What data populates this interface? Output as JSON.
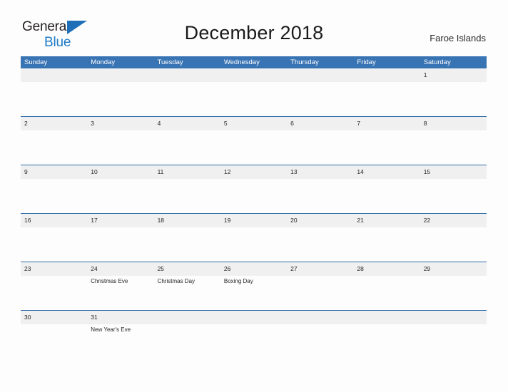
{
  "logo": {
    "word1": "General",
    "word2": "Blue",
    "flag_color": "#1f6fb8",
    "blue_text_color": "#1f7ac7"
  },
  "header": {
    "title": "December 2018",
    "region": "Faroe Islands"
  },
  "theme": {
    "header_blue": "#3873b3",
    "row_divider_blue": "#2e6da8",
    "daynum_band_gray": "#f0f0f0",
    "page_background": "#fdfdfd"
  },
  "calendar": {
    "weekdays": [
      "Sunday",
      "Monday",
      "Tuesday",
      "Wednesday",
      "Thursday",
      "Friday",
      "Saturday"
    ],
    "weeks": [
      [
        {
          "day": "",
          "event": ""
        },
        {
          "day": "",
          "event": ""
        },
        {
          "day": "",
          "event": ""
        },
        {
          "day": "",
          "event": ""
        },
        {
          "day": "",
          "event": ""
        },
        {
          "day": "",
          "event": ""
        },
        {
          "day": "1",
          "event": ""
        }
      ],
      [
        {
          "day": "2",
          "event": ""
        },
        {
          "day": "3",
          "event": ""
        },
        {
          "day": "4",
          "event": ""
        },
        {
          "day": "5",
          "event": ""
        },
        {
          "day": "6",
          "event": ""
        },
        {
          "day": "7",
          "event": ""
        },
        {
          "day": "8",
          "event": ""
        }
      ],
      [
        {
          "day": "9",
          "event": ""
        },
        {
          "day": "10",
          "event": ""
        },
        {
          "day": "11",
          "event": ""
        },
        {
          "day": "12",
          "event": ""
        },
        {
          "day": "13",
          "event": ""
        },
        {
          "day": "14",
          "event": ""
        },
        {
          "day": "15",
          "event": ""
        }
      ],
      [
        {
          "day": "16",
          "event": ""
        },
        {
          "day": "17",
          "event": ""
        },
        {
          "day": "18",
          "event": ""
        },
        {
          "day": "19",
          "event": ""
        },
        {
          "day": "20",
          "event": ""
        },
        {
          "day": "21",
          "event": ""
        },
        {
          "day": "22",
          "event": ""
        }
      ],
      [
        {
          "day": "23",
          "event": ""
        },
        {
          "day": "24",
          "event": "Christmas Eve"
        },
        {
          "day": "25",
          "event": "Christmas Day"
        },
        {
          "day": "26",
          "event": "Boxing Day"
        },
        {
          "day": "27",
          "event": ""
        },
        {
          "day": "28",
          "event": ""
        },
        {
          "day": "29",
          "event": ""
        }
      ],
      [
        {
          "day": "30",
          "event": ""
        },
        {
          "day": "31",
          "event": "New Year's Eve"
        },
        {
          "day": "",
          "event": ""
        },
        {
          "day": "",
          "event": ""
        },
        {
          "day": "",
          "event": ""
        },
        {
          "day": "",
          "event": ""
        },
        {
          "day": "",
          "event": ""
        }
      ]
    ]
  }
}
